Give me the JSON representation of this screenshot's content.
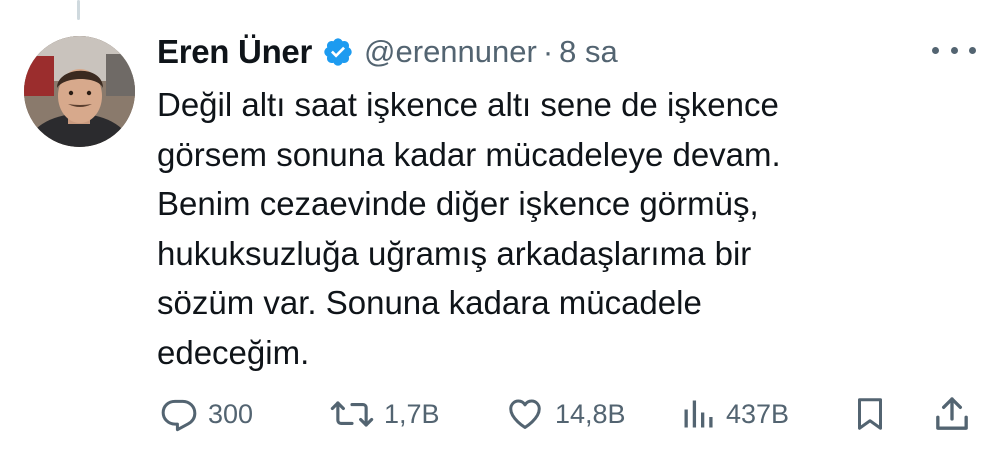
{
  "tweet": {
    "author_name": "Eren Üner",
    "handle": "@erennuner",
    "separator": "·",
    "time": "8 sa",
    "text_lines": [
      "Değil altı saat işkence altı sene de işkence",
      "görsem sonuna kadar mücadeleye devam.",
      "Benim cezaevinde diğer işkence görmüş,",
      "hukuksuzluğa uğramış arkadaşlarıma bir",
      "sözüm var. Sonuna kadara mücadele",
      "edeceğim."
    ]
  },
  "actions": {
    "replies": "300",
    "retweets": "1,7B",
    "likes": "14,8B",
    "views": "437B"
  },
  "icons": {
    "verified": "verified-badge-icon",
    "more": "more-options-icon",
    "reply": "reply-icon",
    "retweet": "retweet-icon",
    "like": "like-icon",
    "views": "views-icon",
    "bookmark": "bookmark-icon",
    "share": "share-icon"
  },
  "colors": {
    "text": "#0f1419",
    "secondary": "#536471",
    "verified": "#1d9bf0"
  }
}
